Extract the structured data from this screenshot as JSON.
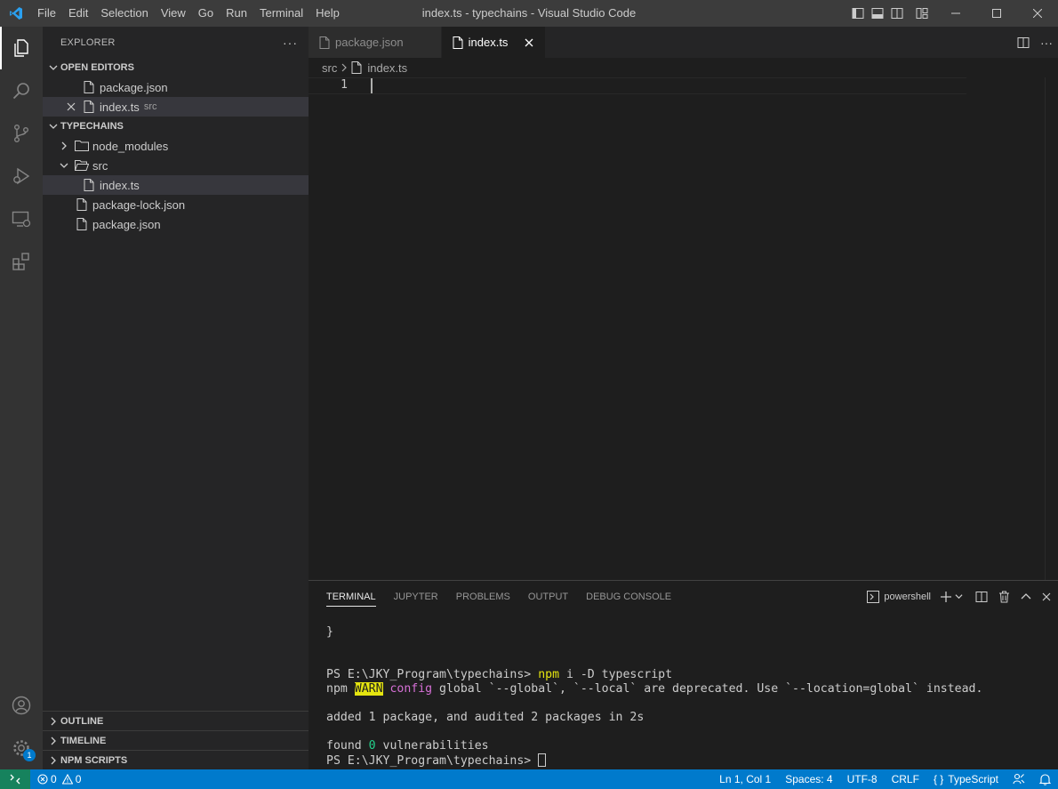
{
  "window": {
    "title": "index.ts - typechains - Visual Studio Code",
    "menu": [
      "File",
      "Edit",
      "Selection",
      "View",
      "Go",
      "Run",
      "Terminal",
      "Help"
    ]
  },
  "sidebar": {
    "title": "EXPLORER",
    "open_editors": {
      "label": "OPEN EDITORS",
      "items": [
        {
          "name": "package.json",
          "desc": ""
        },
        {
          "name": "index.ts",
          "desc": "src"
        }
      ]
    },
    "project": {
      "label": "TYPECHAINS",
      "items": [
        {
          "name": "node_modules",
          "type": "folder-collapsed"
        },
        {
          "name": "src",
          "type": "folder-open"
        },
        {
          "name": "index.ts",
          "type": "file"
        },
        {
          "name": "package-lock.json",
          "type": "file"
        },
        {
          "name": "package.json",
          "type": "file"
        }
      ]
    },
    "outline_label": "OUTLINE",
    "timeline_label": "TIMELINE",
    "npm_scripts_label": "NPM SCRIPTS",
    "settings_badge": "1"
  },
  "editor": {
    "tabs": [
      {
        "label": "package.json",
        "active": false
      },
      {
        "label": "index.ts",
        "active": true
      }
    ],
    "breadcrumb": [
      "src",
      "index.ts"
    ],
    "line_number": "1"
  },
  "panel": {
    "tabs": [
      "TERMINAL",
      "JUPYTER",
      "PROBLEMS",
      "OUTPUT",
      "DEBUG CONSOLE"
    ],
    "shell": "powershell",
    "terminal": {
      "line1": "}",
      "prompt1": "PS E:\\JKY_Program\\typechains> ",
      "cmd_npm": "npm",
      "cmd_rest": " i -D typescript",
      "warn_npm": "npm ",
      "warn_tag": "WARN",
      "warn_config": " config",
      "warn_msg": " global `--global`, `--local` are deprecated. Use `--location=global` instead.",
      "added": "added 1 package, and audited 2 packages in 2s",
      "found_pre": "found ",
      "found_num": "0",
      "found_post": " vulnerabilities",
      "prompt2": "PS E:\\JKY_Program\\typechains> "
    }
  },
  "statusbar": {
    "errors": "0",
    "warnings": "0",
    "position": "Ln 1, Col 1",
    "spaces": "Spaces: 4",
    "encoding": "UTF-8",
    "eol": "CRLF",
    "language": "TypeScript"
  },
  "colors": {
    "accent": "#007acc",
    "remote": "#16825d",
    "titlebar": "#3c3c3c",
    "activitybar": "#333333",
    "sidebar": "#252526",
    "editor": "#1e1e1e"
  }
}
